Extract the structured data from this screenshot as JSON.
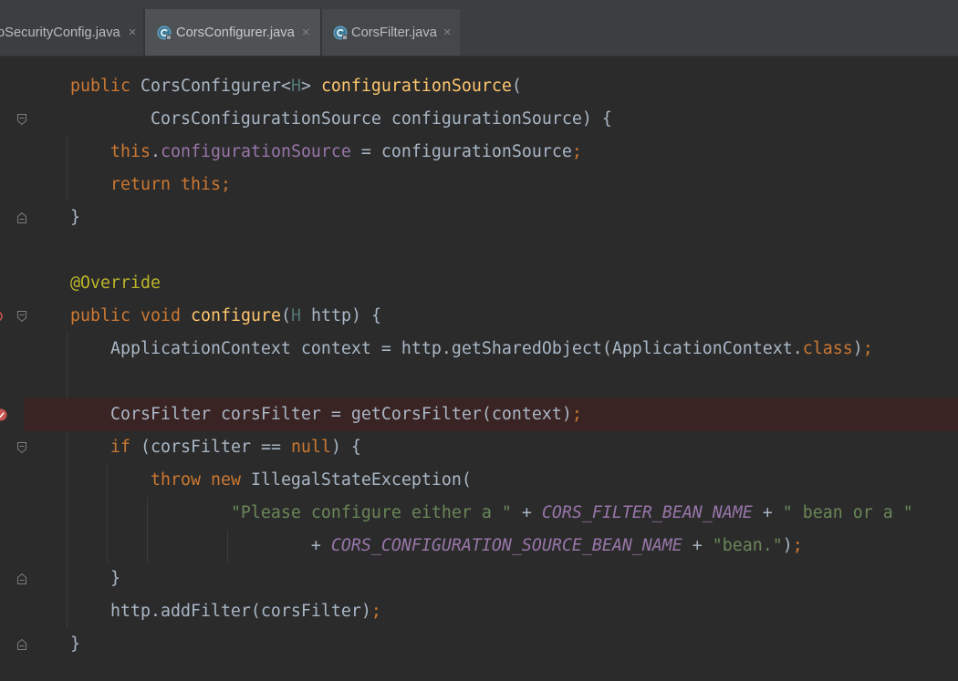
{
  "tabs": [
    {
      "label": "oSecurityConfig.java",
      "close": "×",
      "active": false
    },
    {
      "label": "CorsConfigurer.java",
      "close": "×",
      "icon": "java-class-icon",
      "active": true
    },
    {
      "label": "CorsFilter.java",
      "close": "×",
      "icon": "java-class-icon",
      "active": false
    }
  ],
  "editor": {
    "theme": {
      "background": "#2b2b2b",
      "breakpoint_line": "#3a2323",
      "breakpoint_marker": "#c75450"
    },
    "syntax_colors": {
      "txt": "#a9b7c6",
      "kw": "#cc7832",
      "fn": "#ffc66d",
      "tp": "#507874",
      "fld": "#9876aa",
      "ann": "#bbb529",
      "str": "#6a8759",
      "const": "#9876aa"
    },
    "gutter": {
      "breakpoint_lines": [
        10
      ],
      "override_lines": [
        7
      ],
      "fold_start": [
        1,
        7,
        11
      ],
      "fold_end": [
        4,
        15,
        17
      ]
    },
    "lines": [
      {
        "tokens": [
          [
            "    ",
            "txt"
          ],
          [
            "public",
            "kw"
          ],
          [
            " CorsConfigurer<",
            "txt"
          ],
          [
            "H",
            "tp"
          ],
          [
            "> ",
            "txt"
          ],
          [
            "configurationSource",
            "fn"
          ],
          [
            "(",
            "txt"
          ]
        ]
      },
      {
        "tokens": [
          [
            "            CorsConfigurationSource configurationSource) {",
            "txt"
          ]
        ]
      },
      {
        "tokens": [
          [
            "        ",
            "txt"
          ],
          [
            "this",
            "kw"
          ],
          [
            ".",
            "txt"
          ],
          [
            "configurationSource",
            "fld"
          ],
          [
            " = configurationSource",
            "txt"
          ],
          [
            ";",
            "kw"
          ]
        ]
      },
      {
        "tokens": [
          [
            "        ",
            "txt"
          ],
          [
            "return",
            "kw"
          ],
          [
            " ",
            "txt"
          ],
          [
            "this",
            "kw"
          ],
          [
            ";",
            "kw"
          ]
        ]
      },
      {
        "tokens": [
          [
            "    }",
            "txt"
          ]
        ]
      },
      {
        "tokens": []
      },
      {
        "tokens": [
          [
            "    ",
            "txt"
          ],
          [
            "@Override",
            "ann"
          ]
        ]
      },
      {
        "tokens": [
          [
            "    ",
            "txt"
          ],
          [
            "public",
            "kw"
          ],
          [
            " ",
            "txt"
          ],
          [
            "void",
            "kw"
          ],
          [
            " ",
            "txt"
          ],
          [
            "configure",
            "fn"
          ],
          [
            "(",
            "txt"
          ],
          [
            "H",
            "tp"
          ],
          [
            " http) {",
            "txt"
          ]
        ]
      },
      {
        "tokens": [
          [
            "        ApplicationContext context = http.getSharedObject(ApplicationContext.",
            "txt"
          ],
          [
            "class",
            "kw"
          ],
          [
            ")",
            "txt"
          ],
          [
            ";",
            "kw"
          ]
        ]
      },
      {
        "tokens": []
      },
      {
        "tokens": [
          [
            "        CorsFilter corsFilter = getCorsFilter(context)",
            "txt"
          ],
          [
            ";",
            "kw"
          ]
        ]
      },
      {
        "tokens": [
          [
            "        ",
            "txt"
          ],
          [
            "if",
            "kw"
          ],
          [
            " (corsFilter == ",
            "txt"
          ],
          [
            "null",
            "kw"
          ],
          [
            ") {",
            "txt"
          ]
        ]
      },
      {
        "tokens": [
          [
            "            ",
            "txt"
          ],
          [
            "throw",
            "kw"
          ],
          [
            " ",
            "txt"
          ],
          [
            "new",
            "kw"
          ],
          [
            " IllegalStateException(",
            "txt"
          ]
        ]
      },
      {
        "tokens": [
          [
            "                    ",
            "txt"
          ],
          [
            "\"Please configure either a \"",
            "str"
          ],
          [
            " + ",
            "txt"
          ],
          [
            "CORS_FILTER_BEAN_NAME",
            "const"
          ],
          [
            " + ",
            "txt"
          ],
          [
            "\" bean or a \"",
            "str"
          ]
        ]
      },
      {
        "tokens": [
          [
            "                            + ",
            "txt"
          ],
          [
            "CORS_CONFIGURATION_SOURCE_BEAN_NAME",
            "const"
          ],
          [
            " + ",
            "txt"
          ],
          [
            "\"bean.\"",
            "str"
          ],
          [
            ")",
            "txt"
          ],
          [
            ";",
            "kw"
          ]
        ]
      },
      {
        "tokens": [
          [
            "        }",
            "txt"
          ]
        ]
      },
      {
        "tokens": [
          [
            "        http.addFilter(corsFilter)",
            "txt"
          ],
          [
            ";",
            "kw"
          ]
        ]
      },
      {
        "tokens": [
          [
            "    }",
            "txt"
          ]
        ]
      }
    ]
  }
}
